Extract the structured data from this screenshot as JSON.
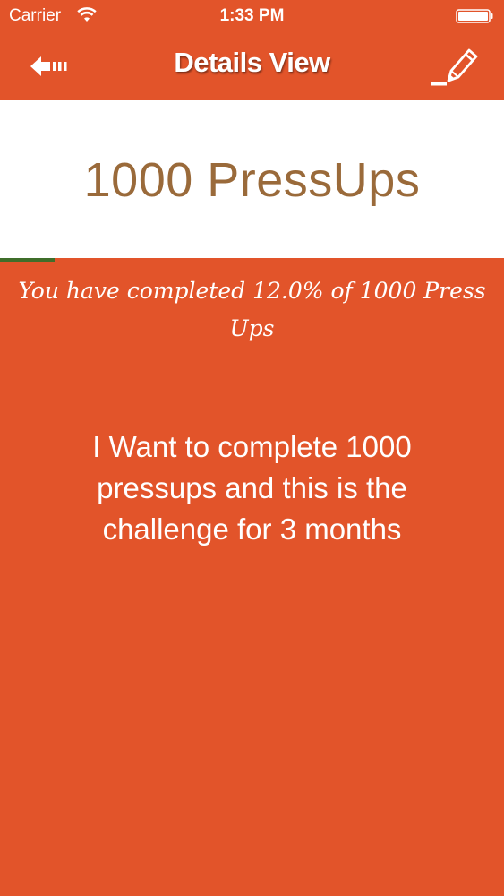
{
  "status_bar": {
    "carrier": "Carrier",
    "time": "1:33 PM"
  },
  "nav": {
    "title": "Details View",
    "back_icon": "back-arrow-icon",
    "edit_icon": "pencil-edit-icon"
  },
  "goal": {
    "title": "1000 PressUps",
    "progress_percent": 12.0,
    "progress_text": "You have completed 12.0% of 1000 Press Ups",
    "description": "I Want to complete 1000 pressups and this is the challenge for 3 months"
  },
  "colors": {
    "background": "#E2542A",
    "title_brown": "#9A6A3A",
    "progress_green": "#3F6E2A",
    "card_white": "#FFFFFF"
  }
}
